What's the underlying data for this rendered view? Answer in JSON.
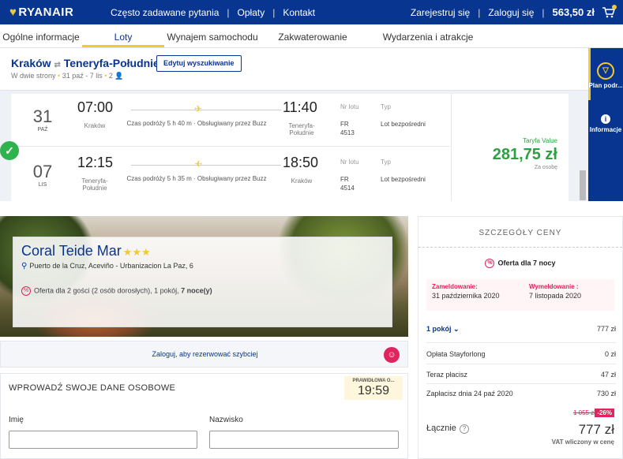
{
  "header": {
    "logo_text": "RYANAIR",
    "nav": [
      "Często zadawane pytania",
      "Opłaty",
      "Kontakt"
    ],
    "register": "Zarejestruj się",
    "login": "Zaloguj się",
    "basket_total": "563,50 zł"
  },
  "tabs": [
    "Ogólne informacje",
    "Loty",
    "Wynajem samochodu",
    "Zakwaterowanie",
    "Wydarzenia i atrakcje"
  ],
  "active_tab": "Loty",
  "search": {
    "route_from": "Kraków",
    "route_to": "Teneryfa-Południe",
    "trip_type": "W dwie strony",
    "dates": "31 paź - 7 lis",
    "passengers": "2",
    "edit_button": "Edytuj wyszukiwanie"
  },
  "side_panel": {
    "plan": "Plan podr...",
    "info": "Informacje"
  },
  "flights": [
    {
      "day": "31",
      "month": "PAŹ",
      "dep_time": "07:00",
      "dep_city": "Kraków",
      "arr_time": "11:40",
      "arr_city": "Teneryfa-Południe",
      "duration": "Czas podróży 5 h 40 m · Obsługiwany przez Buzz",
      "flight_no_label": "Nr lotu",
      "flight_no": "FR 4513",
      "type_label": "Typ",
      "type": "Lot bezpośredni"
    },
    {
      "day": "07",
      "month": "LIS",
      "dep_time": "12:15",
      "dep_city": "Teneryfa-Południe",
      "arr_time": "18:50",
      "arr_city": "Kraków",
      "duration": "Czas podróży 5 h 35 m · Obsługiwany przez Buzz",
      "flight_no_label": "Nr lotu",
      "flight_no": "FR 4514",
      "type_label": "Typ",
      "type": "Lot bezpośredni"
    }
  ],
  "fare": {
    "name": "Taryfa Value",
    "price": "281,75 zł",
    "per": "Za osobę"
  },
  "hotel": {
    "name": "Coral Teide Mar",
    "stars": "★★★",
    "address": "Puerto de la Cruz, Aceviño - Urbanizacion La Paz, 6",
    "offer_prefix": "Oferta dla 2 gości (2 osób dorosłych), 1 pokój, ",
    "offer_nights": "7 noce(y)"
  },
  "login_bar": {
    "text": "Zaloguj, aby rezerwować szybciej"
  },
  "form": {
    "title": "WPROWADŹ SWOJE DANE OSOBOWE",
    "timer_label": "PRAWIDŁOWA O...",
    "timer_value": "19:59",
    "first_name_label": "Imię",
    "last_name_label": "Nazwisko",
    "first_name_value": "",
    "last_name_value": ""
  },
  "price_details": {
    "title": "SZCZEGÓŁY CENY",
    "offer": "Oferta dla 7 nocy",
    "checkin_label": "Zameldowanie:",
    "checkin_date": "31 października 2020",
    "checkout_label": "Wymeldowanie :",
    "checkout_date": "7 listopada 2020",
    "rooms_label": "1 pokój",
    "rooms_price": "777 zł",
    "fee_label": "Opłata Stayforlong",
    "fee_value": "0 zł",
    "pay_now_label": "Teraz płacisz",
    "pay_now_value": "47 zł",
    "pay_later_label": "Zapłacisz dnia 24 paź 2020",
    "pay_later_value": "730 zł",
    "old_price": "1 055 zł",
    "discount": "-26%",
    "total_label": "Łącznie",
    "total_value": "777 zł",
    "vat_note": "VAT wliczony w cenę"
  },
  "colors": {
    "brand_blue": "#073590",
    "brand_yellow": "#f1c933",
    "fare_green": "#2f9e44",
    "accent_pink": "#e0245e"
  }
}
